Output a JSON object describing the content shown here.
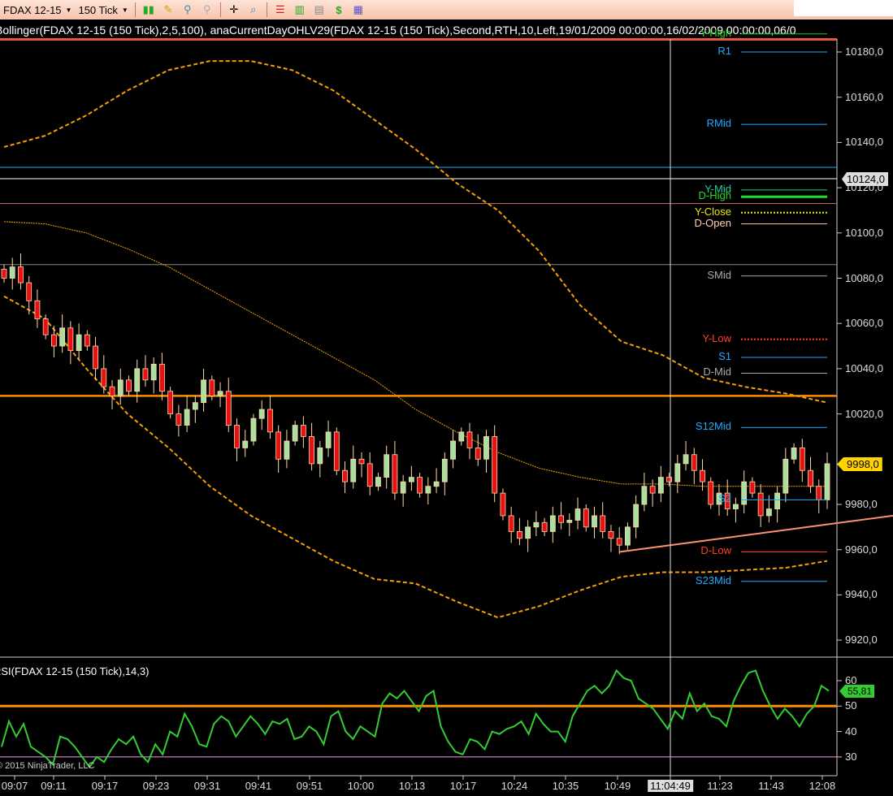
{
  "toolbar": {
    "instrument": "FDAX 12-15",
    "period": "150 Tick",
    "icons": [
      "bar-type-icon",
      "pencil-icon",
      "zoom-in-icon",
      "zoom-out-icon",
      "crosshair-icon",
      "magnifier-icon",
      "strategies-icon",
      "indicators-icon",
      "chart-data-icon",
      "order-dollar-icon",
      "properties-icon"
    ]
  },
  "title": "Bollinger(FDAX  12-15  (150  Tick),2,5,100),  anaCurrentDayOHLV29(FDAX  12-15  (150  Tick),Second,RTH,10,Left,19/01/2009  00:00:00,16/02/2009  00:00:00,06/0",
  "price_axis": {
    "ticks": [
      "10180,0",
      "10160,0",
      "10140,0",
      "10120,0",
      "10100,0",
      "10080,0",
      "10060,0",
      "10040,0",
      "10020,0",
      "9980,0",
      "9960,0",
      "9940,0",
      "9920,0"
    ],
    "tick_values": [
      10180,
      10160,
      10140,
      10120,
      10100,
      10080,
      10060,
      10040,
      10020,
      9980,
      9960,
      9940,
      9920
    ],
    "crosshair_price": "10124,0",
    "last_price": "9998,0"
  },
  "levels": [
    {
      "label": "Y-High",
      "price": 10188,
      "color": "#22cc22",
      "style": "solid"
    },
    {
      "label": "R1",
      "price": 10180,
      "color": "#1eaaff",
      "style": "solid"
    },
    {
      "label": "RMid",
      "price": 10148,
      "color": "#1eaaff",
      "style": "solid"
    },
    {
      "label": "Y-Mid",
      "price": 10119,
      "color": "#20d0a0",
      "style": "solid"
    },
    {
      "label": "D-High",
      "price": 10116,
      "color": "#22dd22",
      "style": "thick"
    },
    {
      "label": "Y-Close",
      "price": 10109,
      "color": "#e8e800",
      "style": "dotted"
    },
    {
      "label": "D-Open",
      "price": 10104,
      "color": "#ffd0b0",
      "style": "solid"
    },
    {
      "label": "SMid",
      "price": 10081,
      "color": "#aaaaaa",
      "style": "solid"
    },
    {
      "label": "Y-Low",
      "price": 10053,
      "color": "#ff4020",
      "style": "dotted"
    },
    {
      "label": "S1",
      "price": 10045,
      "color": "#1eaaff",
      "style": "solid"
    },
    {
      "label": "D-Mid",
      "price": 10038,
      "color": "#aaaaaa",
      "style": "solid"
    },
    {
      "label": "S12Mid",
      "price": 10014,
      "color": "#1eaaff",
      "style": "solid"
    },
    {
      "label": "S2",
      "price": 9982,
      "color": "#1eaaff",
      "style": "solid"
    },
    {
      "label": "D-Low",
      "price": 9959,
      "color": "#ff4020",
      "style": "solid"
    },
    {
      "label": "S23Mid",
      "price": 9946,
      "color": "#1eaaff",
      "style": "solid"
    }
  ],
  "rsi": {
    "title": "RSI(FDAX 12-15 (150 Tick),14,3)",
    "ticks": [
      "60",
      "50",
      "40",
      "30"
    ],
    "tick_values": [
      60,
      50,
      40,
      30
    ],
    "last": "55,81",
    "upper_line": 50,
    "lower_line": 30
  },
  "copyright": "© 2015 NinjaTrader, LLC",
  "time_axis": {
    "labels": [
      "09:07",
      "09:11",
      "09:17",
      "09:23",
      "09:31",
      "09:41",
      "09:51",
      "10:00",
      "10:13",
      "10:17",
      "10:24",
      "10:35",
      "10:49",
      "11:04:49",
      "11:23",
      "11:43",
      "12:08"
    ]
  },
  "chart_data": {
    "type": "candlestick",
    "closes": [
      10080,
      10085,
      10078,
      10070,
      10062,
      10055,
      10050,
      10058,
      10048,
      10055,
      10050,
      10040,
      10032,
      10028,
      10035,
      10030,
      10040,
      10035,
      10042,
      10030,
      10020,
      10015,
      10022,
      10025,
      10035,
      10028,
      10030,
      10015,
      10005,
      10008,
      10018,
      10022,
      10012,
      10000,
      10008,
      10015,
      10010,
      9998,
      10005,
      10012,
      9995,
      9990,
      10000,
      9998,
      9988,
      9992,
      10002,
      9985,
      9990,
      9992,
      9985,
      9988,
      9990,
      10000,
      10008,
      10012,
      10005,
      10000,
      10010,
      9985,
      9975,
      9968,
      9965,
      9970,
      9972,
      9968,
      9975,
      9972,
      9973,
      9978,
      9970,
      9975,
      9968,
      9965,
      9962,
      9970,
      9980,
      9988,
      9985,
      9992,
      9990,
      9998,
      10002,
      9995,
      9990,
      9980,
      9985,
      9978,
      9980,
      9990,
      9985,
      9975,
      9978,
      9985,
      10000,
      10005,
      9995,
      9988,
      9982,
      9998
    ],
    "bollinger_upper": [
      10138,
      10143,
      10152,
      10163,
      10172,
      10176,
      10176,
      10172,
      10163,
      10150,
      10137,
      10122,
      10110,
      10092,
      10068,
      10052,
      10046,
      10036,
      10032,
      10029,
      10025
    ],
    "bollinger_mid": [
      10105,
      10104,
      10100,
      10093,
      10085,
      10075,
      10065,
      10055,
      10045,
      10035,
      10022,
      10012,
      10003,
      9996,
      9992,
      9989,
      9989,
      9988,
      9988,
      9988,
      9988
    ],
    "bollinger_lower": [
      10072,
      10062,
      10040,
      10020,
      10005,
      9988,
      9975,
      9965,
      9955,
      9947,
      9945,
      9937,
      9930,
      9935,
      9942,
      9948,
      9950,
      9950,
      9951,
      9952,
      9955
    ],
    "hlines": [
      {
        "price": 10129,
        "color": "#1eaaff"
      },
      {
        "price": 10124,
        "color": "#ffffff"
      },
      {
        "price": 10113,
        "color": "#c87070"
      },
      {
        "price": 10086,
        "color": "#888888"
      },
      {
        "price": 10028,
        "color": "#ff8c00"
      }
    ],
    "trendline": {
      "from": [
        74,
        9959
      ],
      "to": [
        104,
        9975
      ]
    },
    "rsi_values": [
      34,
      44,
      38,
      43,
      34,
      32,
      30,
      27,
      38,
      37,
      34,
      30,
      26,
      30,
      28,
      33,
      37,
      35,
      38,
      31,
      28,
      35,
      31,
      40,
      38,
      47,
      42,
      35,
      34,
      43,
      46,
      44,
      38,
      42,
      46,
      43,
      39,
      44,
      43,
      45,
      37,
      38,
      42,
      40,
      35,
      46,
      48,
      40,
      37,
      42,
      40,
      38,
      51,
      55,
      53,
      56,
      52,
      48,
      54,
      56,
      42,
      36,
      32,
      31,
      37,
      36,
      33,
      40,
      39,
      41,
      42,
      44,
      39,
      47,
      43,
      40,
      40,
      36,
      46,
      51,
      56,
      58,
      55,
      58,
      64,
      61,
      60,
      53,
      51,
      49,
      45,
      41,
      48,
      45,
      55,
      48,
      51,
      46,
      45,
      42,
      52,
      58,
      63,
      64,
      56,
      50,
      45,
      49,
      46,
      42,
      47,
      50,
      58,
      56
    ],
    "ylim": [
      9910,
      10190
    ],
    "rsi_ylim": [
      24,
      68
    ]
  }
}
